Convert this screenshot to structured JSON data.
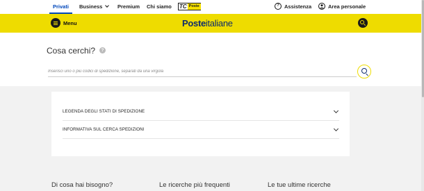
{
  "topnav": {
    "privati": "Privati",
    "business": "Business",
    "premium": "Premium",
    "chi_siamo": "Chi siamo",
    "tc_badge_tc": "TC",
    "tc_badge_poste": "Poste",
    "assistenza": "Assistenza",
    "area_personale": "Area personale"
  },
  "header": {
    "menu_label": "Menu",
    "logo_bold": "Poste",
    "logo_light": "italiane"
  },
  "search": {
    "title": "Cosa cerchi?",
    "placeholder": "Inserisci uno o più codici di spedizione, separati da una virgola",
    "help_icon_glyph": "?"
  },
  "accordion": {
    "items": [
      {
        "label": "LEGENDA DEGLI STATI DI SPEDIZIONE"
      },
      {
        "label": "INFORMATIVA SUL CERCA SPEDIZIONI"
      }
    ]
  },
  "footer": {
    "col1": "Di cosa hai bisogno?",
    "col2": "Le ricerche più frequenti",
    "col3": "Le tue ultime ricerche"
  },
  "colors": {
    "brand_yellow": "#eedc00",
    "brand_blue": "#0047bb",
    "logo_navy": "#0d2c6c"
  },
  "icons": {
    "assistenza": "question-circle-icon",
    "area_personale": "user-circle-icon",
    "menu": "hamburger-icon",
    "search": "search-icon"
  }
}
